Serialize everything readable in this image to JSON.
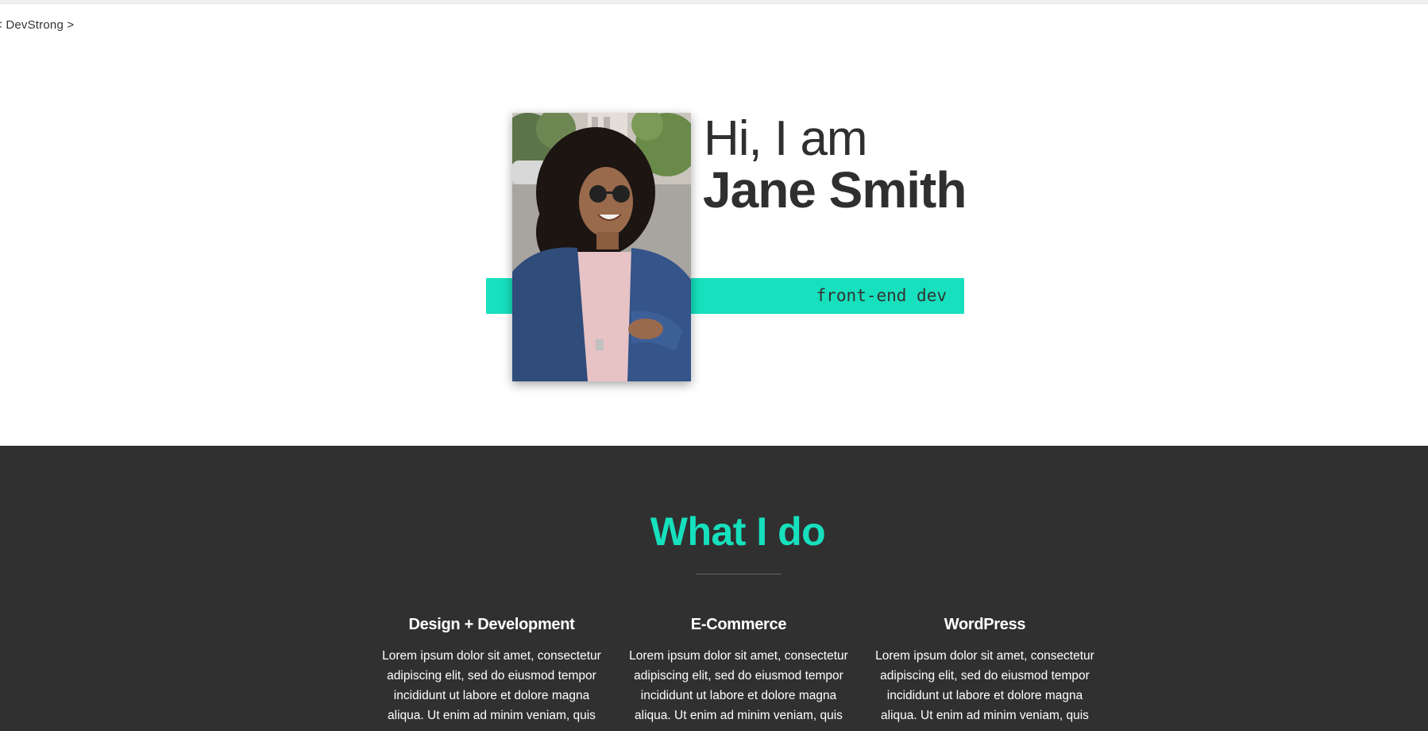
{
  "header": {
    "logo_text": "< DevStrong >"
  },
  "hero": {
    "greeting": "Hi, I am",
    "name": "Jane Smith",
    "role": "front-end dev",
    "accent_color": "#16e0bd",
    "photo_icon": "portrait-photo"
  },
  "services": {
    "title": "What I do",
    "background_color": "#303030",
    "items": [
      {
        "title": "Design + Development",
        "text": "Lorem ipsum dolor sit amet, consectetur adipiscing elit, sed do eiusmod tempor incididunt ut labore et dolore magna aliqua. Ut enim ad minim veniam, quis"
      },
      {
        "title": "E-Commerce",
        "text": "Lorem ipsum dolor sit amet, consectetur adipiscing elit, sed do eiusmod tempor incididunt ut labore et dolore magna aliqua. Ut enim ad minim veniam, quis"
      },
      {
        "title": "WordPress",
        "text": "Lorem ipsum dolor sit amet, consectetur adipiscing elit, sed do eiusmod tempor incididunt ut labore et dolore magna aliqua. Ut enim ad minim veniam, quis"
      }
    ]
  }
}
